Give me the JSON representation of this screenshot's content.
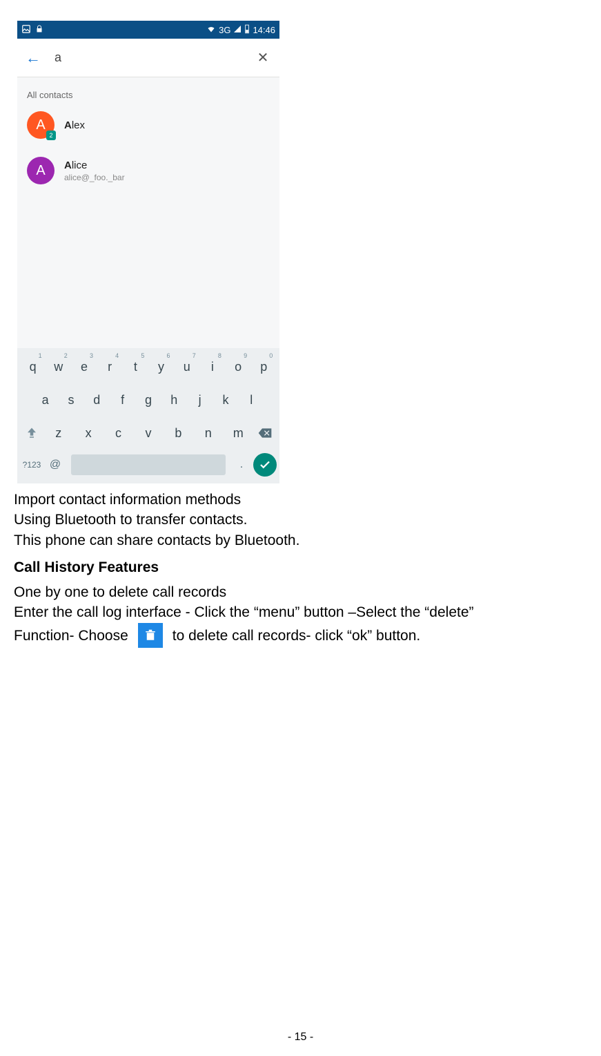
{
  "status": {
    "network": "3G",
    "time": "14:46"
  },
  "search": {
    "query": "a",
    "section": "All contacts"
  },
  "contacts": [
    {
      "bold": "A",
      "rest": "lex",
      "sub": "",
      "sim": "2"
    },
    {
      "bold": "A",
      "rest": "lice",
      "sub": "alice@_foo._bar",
      "sim": ""
    }
  ],
  "kb": {
    "row1": [
      {
        "k": "q",
        "h": "1"
      },
      {
        "k": "w",
        "h": "2"
      },
      {
        "k": "e",
        "h": "3"
      },
      {
        "k": "r",
        "h": "4"
      },
      {
        "k": "t",
        "h": "5"
      },
      {
        "k": "y",
        "h": "6"
      },
      {
        "k": "u",
        "h": "7"
      },
      {
        "k": "i",
        "h": "8"
      },
      {
        "k": "o",
        "h": "9"
      },
      {
        "k": "p",
        "h": "0"
      }
    ],
    "row2": [
      "a",
      "s",
      "d",
      "f",
      "g",
      "h",
      "j",
      "k",
      "l"
    ],
    "row3": [
      "z",
      "x",
      "c",
      "v",
      "b",
      "n",
      "m"
    ],
    "num": "?123",
    "at": "@",
    "dot": "."
  },
  "text": {
    "p1": "Import contact information methods",
    "p2": "Using Bluetooth to transfer contacts.",
    "p3": "This phone can share contacts by Bluetooth.",
    "h1": "Call History Features",
    "p4": "One by one to delete call records",
    "p5": "Enter the call log interface - Click the “menu” button –Select the “delete”",
    "p6a": "Function- Choose",
    "p6b": "to delete call records- click “ok” button."
  },
  "page_number": "- 15 -"
}
